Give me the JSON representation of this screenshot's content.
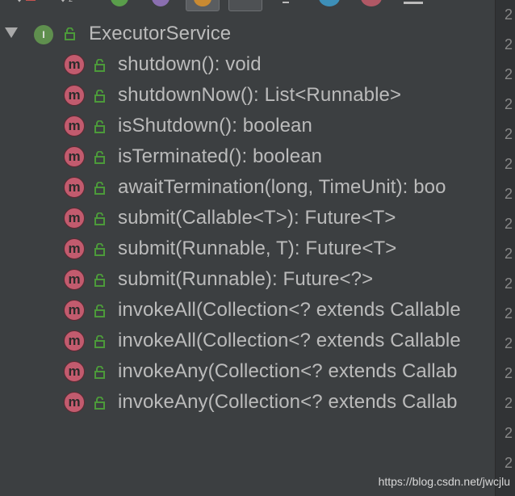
{
  "toolbar": {
    "icons": [
      "sort-visibility-icon",
      "sort-alpha-icon",
      "field-filter-icon",
      "property-filter-icon",
      "show-inherited-icon",
      "show-lambdas-icon",
      "collapse-icon",
      "anonymous-class-icon",
      "method-filter-icon",
      "menu-icon"
    ]
  },
  "tree": {
    "root": {
      "label": "ExecutorService",
      "badge": "I",
      "expanded": true
    },
    "methods": [
      {
        "badge": "m",
        "label": "shutdown(): void"
      },
      {
        "badge": "m",
        "label": "shutdownNow(): List<Runnable>"
      },
      {
        "badge": "m",
        "label": "isShutdown(): boolean"
      },
      {
        "badge": "m",
        "label": "isTerminated(): boolean"
      },
      {
        "badge": "m",
        "label": "awaitTermination(long, TimeUnit): boo"
      },
      {
        "badge": "m",
        "label": "submit(Callable<T>): Future<T>"
      },
      {
        "badge": "m",
        "label": "submit(Runnable, T): Future<T>"
      },
      {
        "badge": "m",
        "label": "submit(Runnable): Future<?>"
      },
      {
        "badge": "m",
        "label": "invokeAll(Collection<? extends Callable"
      },
      {
        "badge": "m",
        "label": "invokeAll(Collection<? extends Callable"
      },
      {
        "badge": "m",
        "label": "invokeAny(Collection<? extends Callab"
      },
      {
        "badge": "m",
        "label": "invokeAny(Collection<? extends Callab"
      }
    ]
  },
  "gutter": {
    "digit": "2"
  },
  "watermark": "https://blog.csdn.net/jwcjlu",
  "colors": {
    "background": "#3c3f41",
    "method_badge": "#c25b6e",
    "interface_badge": "#5f8f4e",
    "lock": "#4c9a3a",
    "text": "#bbbbbb"
  }
}
